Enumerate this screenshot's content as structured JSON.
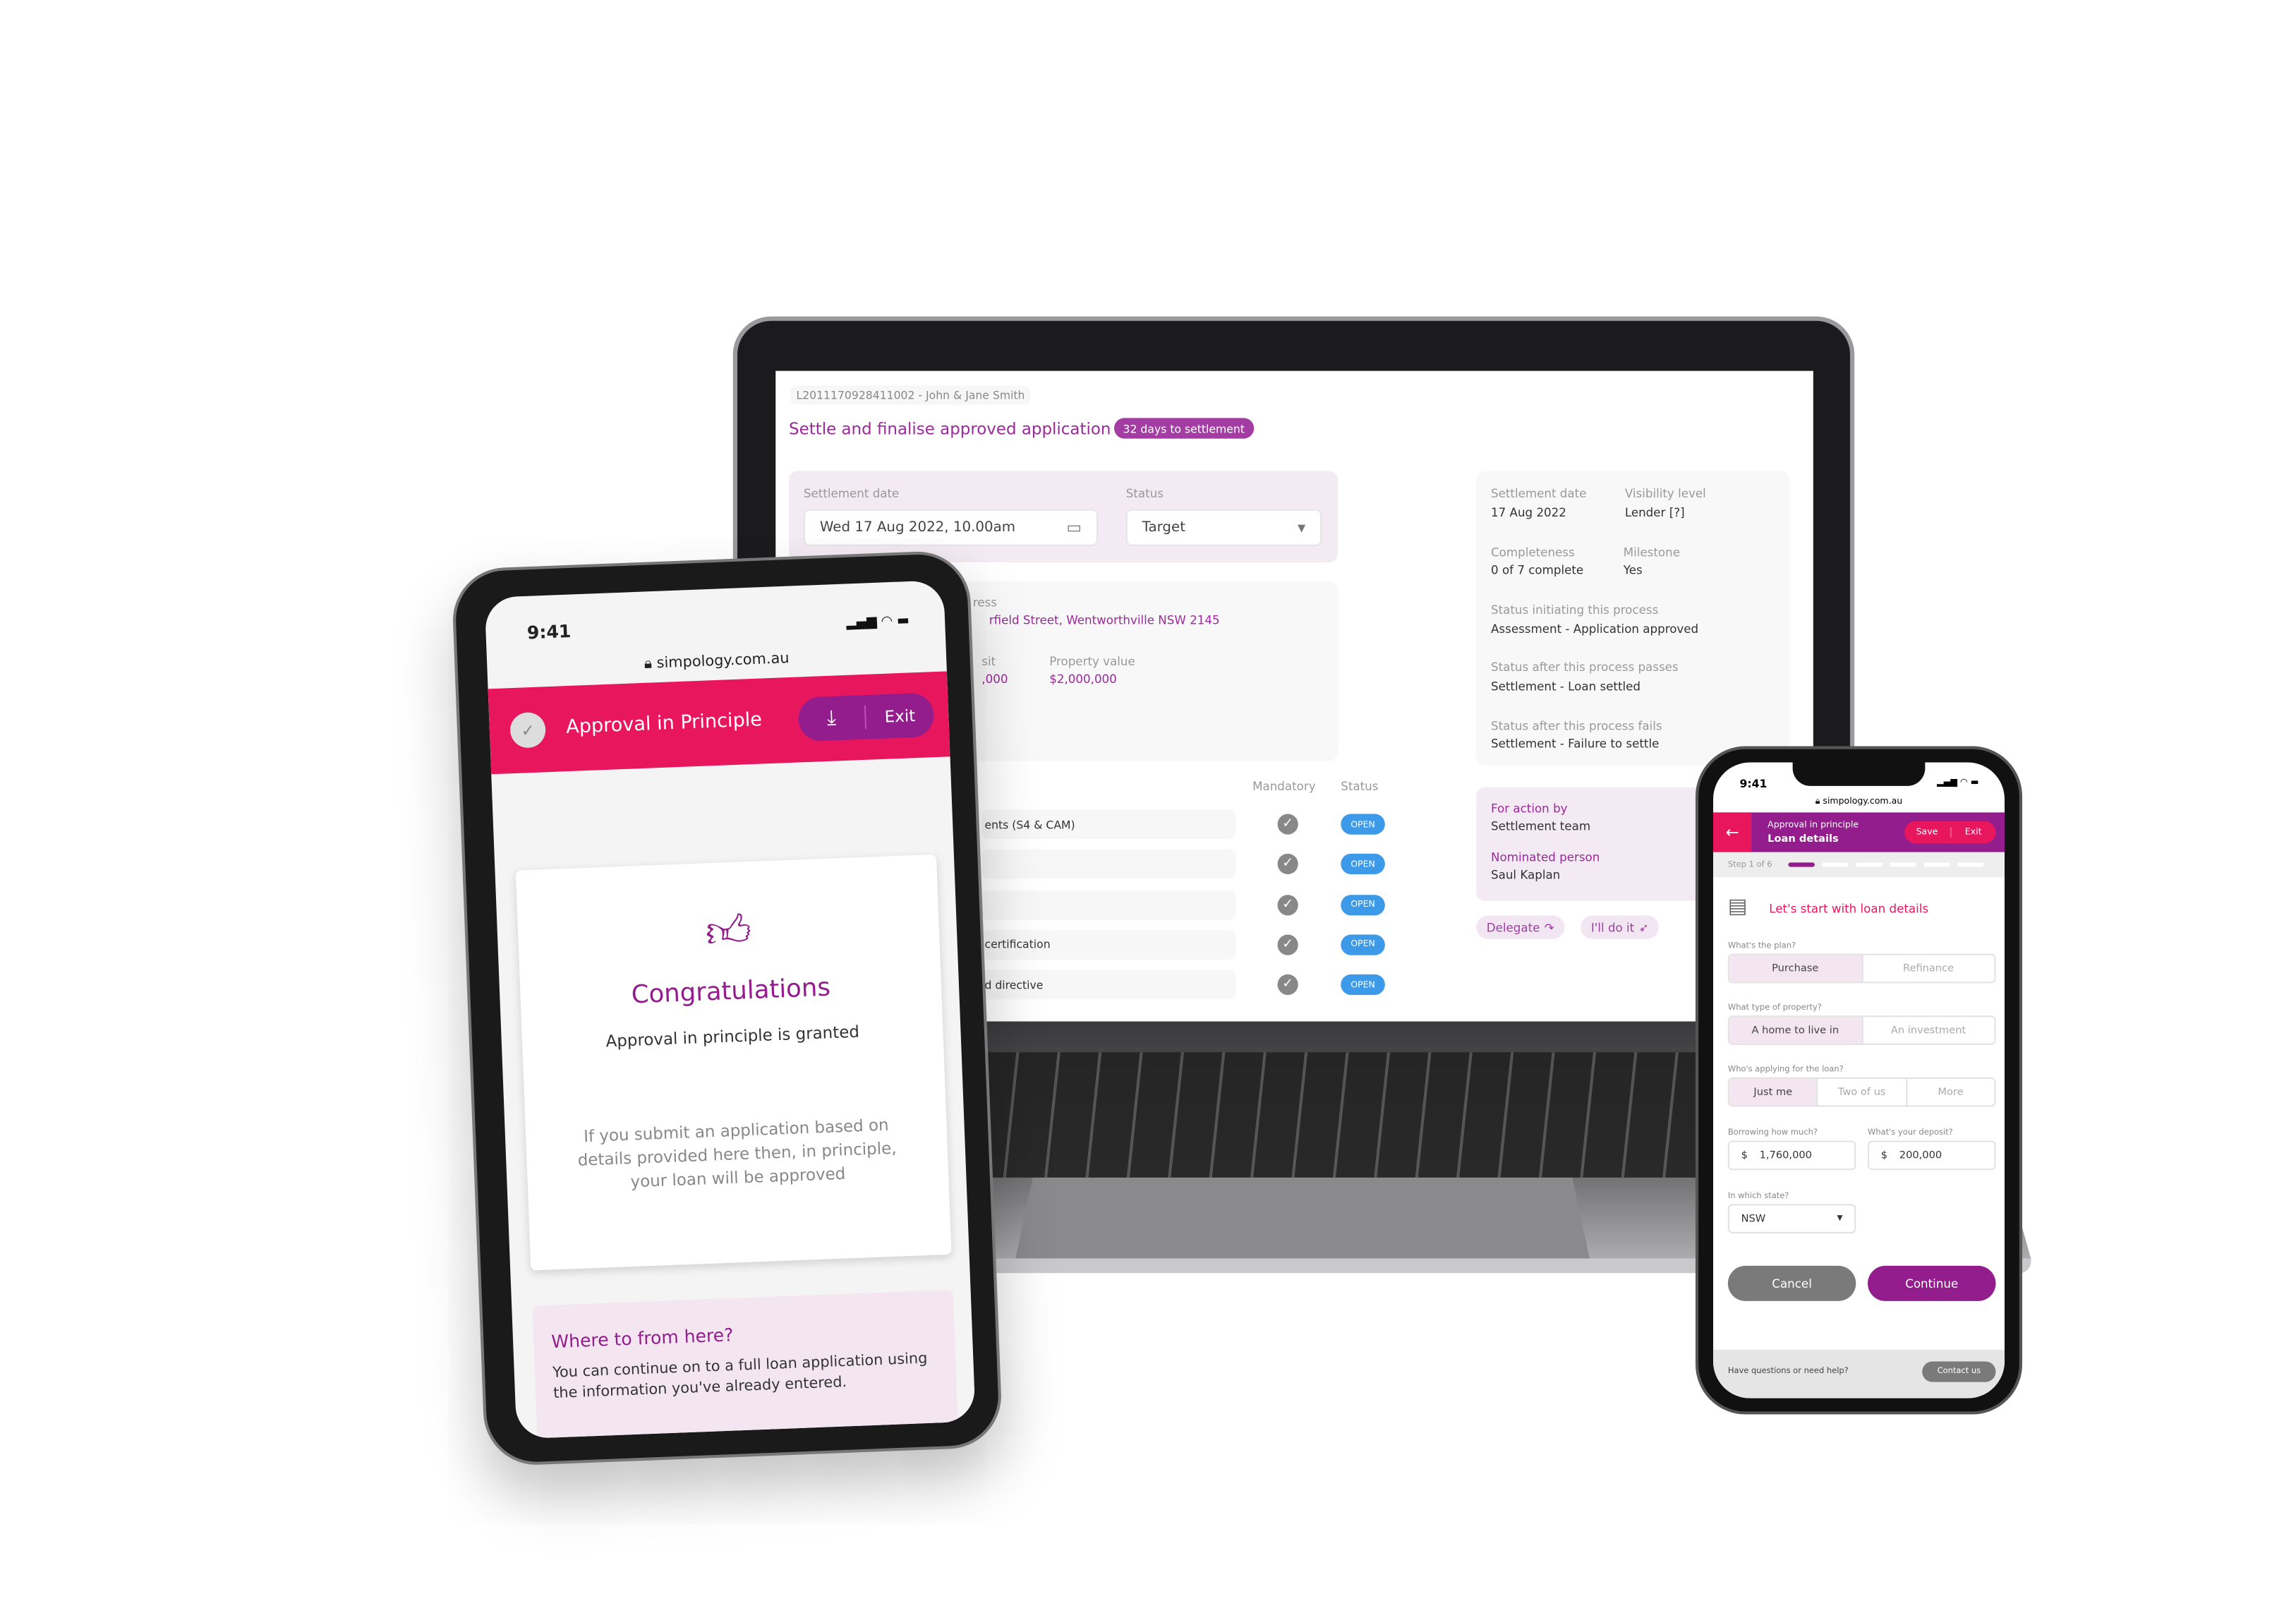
{
  "desktop": {
    "breadcrumb": "L2011170928411002 - John & Jane Smith",
    "title": "Settle and finalise approved application",
    "badge": "32 days to settlement",
    "settlement_date_label": "Settlement date",
    "settlement_date_value": "Wed 17 Aug 2022, 10.00am",
    "status_label": "Status",
    "status_value": "Target",
    "address_label": "ress",
    "address_value": "rfield Street, Wentworthville NSW 2145",
    "deposit_label": "sit",
    "deposit_value": ",000",
    "property_value_label": "Property value",
    "property_value": "$2,000,000",
    "info": [
      {
        "label": "Settlement date",
        "value": "17 Aug 2022"
      },
      {
        "label": "Visibility level",
        "value": "Lender [?]"
      },
      {
        "label": "Completeness",
        "value": "0 of 7 complete"
      },
      {
        "label": "Milestone",
        "value": "Yes"
      },
      {
        "label": "Status initiating this process",
        "value": "Assessment - Application approved"
      },
      {
        "label": "Status after this process passes",
        "value": "Settlement - Loan settled"
      },
      {
        "label": "Status after this process fails",
        "value": "Settlement - Failure to settle"
      }
    ],
    "col_mandatory": "Mandatory",
    "col_status": "Status",
    "tasks": [
      {
        "name": "ents (S4 & CAM)",
        "status": "OPEN"
      },
      {
        "name": "",
        "status": "OPEN"
      },
      {
        "name": "",
        "status": "OPEN"
      },
      {
        "name": "certification",
        "status": "OPEN"
      },
      {
        "name": "d directive",
        "status": "OPEN"
      }
    ],
    "action_by_label": "For action by",
    "action_by_value": "Settlement team",
    "nominated_label": "Nominated person",
    "nominated_value": "Saul Kaplan",
    "delegate": "Delegate",
    "do_it": "I'll do it"
  },
  "tablet": {
    "time": "9:41",
    "url": "simpology.com.au",
    "header": "Approval in Principle",
    "exit": "Exit",
    "congrats": "Congratulations",
    "granted": "Approval in principle is granted",
    "body": "If you submit an application based on details provided here then, in principle, your loan will be approved",
    "next_title": "Where to from here?",
    "next_body": "You can continue on to a full loan application using the information you've already entered."
  },
  "phone": {
    "time": "9:41",
    "url": "simpology.com.au",
    "header_sub": "Approval in principle",
    "header_title": "Loan details",
    "save": "Save",
    "exit": "Exit",
    "step": "Step 1 of 6",
    "progress": {
      "current": 1,
      "total": 6
    },
    "section_title": "Let's start with loan details",
    "plan_label": "What's the plan?",
    "plan_options": [
      "Purchase",
      "Refinance"
    ],
    "property_label": "What type of property?",
    "property_options": [
      "A home to live in",
      "An investment"
    ],
    "applicants_label": "Who's applying for the loan?",
    "applicant_options": [
      "Just me",
      "Two of us",
      "More"
    ],
    "borrow_label": "Borrowing how much?",
    "borrow_value": "1,760,000",
    "deposit_label": "What's your deposit?",
    "deposit_value": "200,000",
    "currency": "$",
    "state_label": "In which state?",
    "state_value": "NSW",
    "cancel": "Cancel",
    "continue": "Continue",
    "help": "Have questions or need help?",
    "contact": "Contact us"
  },
  "colors": {
    "purple": "#931d8c",
    "pink": "#e8175d",
    "blue": "#3d9ae8"
  }
}
